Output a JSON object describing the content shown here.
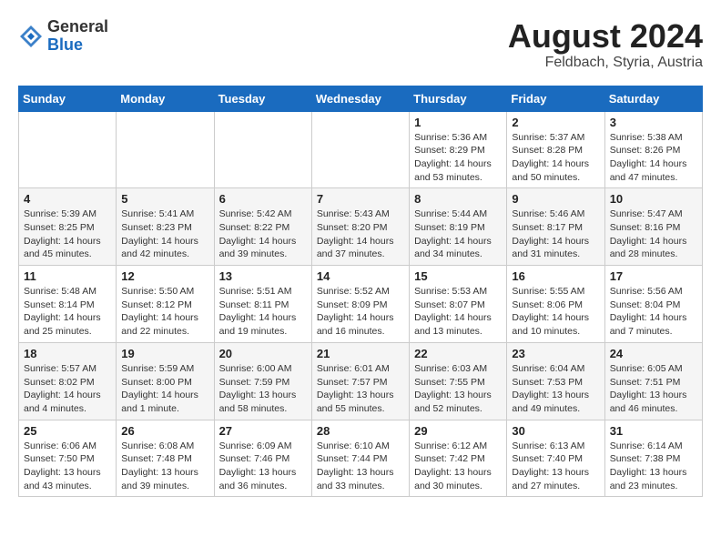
{
  "logo": {
    "general": "General",
    "blue": "Blue"
  },
  "header": {
    "month": "August 2024",
    "location": "Feldbach, Styria, Austria"
  },
  "weekdays": [
    "Sunday",
    "Monday",
    "Tuesday",
    "Wednesday",
    "Thursday",
    "Friday",
    "Saturday"
  ],
  "weeks": [
    [
      {
        "day": "",
        "info": ""
      },
      {
        "day": "",
        "info": ""
      },
      {
        "day": "",
        "info": ""
      },
      {
        "day": "",
        "info": ""
      },
      {
        "day": "1",
        "info": "Sunrise: 5:36 AM\nSunset: 8:29 PM\nDaylight: 14 hours and 53 minutes."
      },
      {
        "day": "2",
        "info": "Sunrise: 5:37 AM\nSunset: 8:28 PM\nDaylight: 14 hours and 50 minutes."
      },
      {
        "day": "3",
        "info": "Sunrise: 5:38 AM\nSunset: 8:26 PM\nDaylight: 14 hours and 47 minutes."
      }
    ],
    [
      {
        "day": "4",
        "info": "Sunrise: 5:39 AM\nSunset: 8:25 PM\nDaylight: 14 hours and 45 minutes."
      },
      {
        "day": "5",
        "info": "Sunrise: 5:41 AM\nSunset: 8:23 PM\nDaylight: 14 hours and 42 minutes."
      },
      {
        "day": "6",
        "info": "Sunrise: 5:42 AM\nSunset: 8:22 PM\nDaylight: 14 hours and 39 minutes."
      },
      {
        "day": "7",
        "info": "Sunrise: 5:43 AM\nSunset: 8:20 PM\nDaylight: 14 hours and 37 minutes."
      },
      {
        "day": "8",
        "info": "Sunrise: 5:44 AM\nSunset: 8:19 PM\nDaylight: 14 hours and 34 minutes."
      },
      {
        "day": "9",
        "info": "Sunrise: 5:46 AM\nSunset: 8:17 PM\nDaylight: 14 hours and 31 minutes."
      },
      {
        "day": "10",
        "info": "Sunrise: 5:47 AM\nSunset: 8:16 PM\nDaylight: 14 hours and 28 minutes."
      }
    ],
    [
      {
        "day": "11",
        "info": "Sunrise: 5:48 AM\nSunset: 8:14 PM\nDaylight: 14 hours and 25 minutes."
      },
      {
        "day": "12",
        "info": "Sunrise: 5:50 AM\nSunset: 8:12 PM\nDaylight: 14 hours and 22 minutes."
      },
      {
        "day": "13",
        "info": "Sunrise: 5:51 AM\nSunset: 8:11 PM\nDaylight: 14 hours and 19 minutes."
      },
      {
        "day": "14",
        "info": "Sunrise: 5:52 AM\nSunset: 8:09 PM\nDaylight: 14 hours and 16 minutes."
      },
      {
        "day": "15",
        "info": "Sunrise: 5:53 AM\nSunset: 8:07 PM\nDaylight: 14 hours and 13 minutes."
      },
      {
        "day": "16",
        "info": "Sunrise: 5:55 AM\nSunset: 8:06 PM\nDaylight: 14 hours and 10 minutes."
      },
      {
        "day": "17",
        "info": "Sunrise: 5:56 AM\nSunset: 8:04 PM\nDaylight: 14 hours and 7 minutes."
      }
    ],
    [
      {
        "day": "18",
        "info": "Sunrise: 5:57 AM\nSunset: 8:02 PM\nDaylight: 14 hours and 4 minutes."
      },
      {
        "day": "19",
        "info": "Sunrise: 5:59 AM\nSunset: 8:00 PM\nDaylight: 14 hours and 1 minute."
      },
      {
        "day": "20",
        "info": "Sunrise: 6:00 AM\nSunset: 7:59 PM\nDaylight: 13 hours and 58 minutes."
      },
      {
        "day": "21",
        "info": "Sunrise: 6:01 AM\nSunset: 7:57 PM\nDaylight: 13 hours and 55 minutes."
      },
      {
        "day": "22",
        "info": "Sunrise: 6:03 AM\nSunset: 7:55 PM\nDaylight: 13 hours and 52 minutes."
      },
      {
        "day": "23",
        "info": "Sunrise: 6:04 AM\nSunset: 7:53 PM\nDaylight: 13 hours and 49 minutes."
      },
      {
        "day": "24",
        "info": "Sunrise: 6:05 AM\nSunset: 7:51 PM\nDaylight: 13 hours and 46 minutes."
      }
    ],
    [
      {
        "day": "25",
        "info": "Sunrise: 6:06 AM\nSunset: 7:50 PM\nDaylight: 13 hours and 43 minutes."
      },
      {
        "day": "26",
        "info": "Sunrise: 6:08 AM\nSunset: 7:48 PM\nDaylight: 13 hours and 39 minutes."
      },
      {
        "day": "27",
        "info": "Sunrise: 6:09 AM\nSunset: 7:46 PM\nDaylight: 13 hours and 36 minutes."
      },
      {
        "day": "28",
        "info": "Sunrise: 6:10 AM\nSunset: 7:44 PM\nDaylight: 13 hours and 33 minutes."
      },
      {
        "day": "29",
        "info": "Sunrise: 6:12 AM\nSunset: 7:42 PM\nDaylight: 13 hours and 30 minutes."
      },
      {
        "day": "30",
        "info": "Sunrise: 6:13 AM\nSunset: 7:40 PM\nDaylight: 13 hours and 27 minutes."
      },
      {
        "day": "31",
        "info": "Sunrise: 6:14 AM\nSunset: 7:38 PM\nDaylight: 13 hours and 23 minutes."
      }
    ]
  ]
}
